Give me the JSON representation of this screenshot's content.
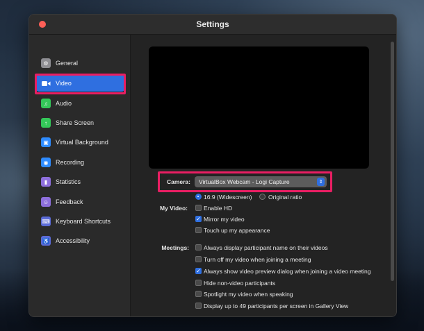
{
  "window": {
    "title": "Settings"
  },
  "sidebar": {
    "items": [
      {
        "label": "General",
        "icon": "gear-icon",
        "color": "#8e8e93"
      },
      {
        "label": "Video",
        "icon": "video-camera-icon",
        "color": "#2f6fe0",
        "active": true
      },
      {
        "label": "Audio",
        "icon": "headphones-icon",
        "color": "#34c759"
      },
      {
        "label": "Share Screen",
        "icon": "share-screen-icon",
        "color": "#34c759"
      },
      {
        "label": "Virtual Background",
        "icon": "person-background-icon",
        "color": "#2f8cff"
      },
      {
        "label": "Recording",
        "icon": "record-icon",
        "color": "#2f8cff"
      },
      {
        "label": "Statistics",
        "icon": "bar-chart-icon",
        "color": "#8e6fdc"
      },
      {
        "label": "Feedback",
        "icon": "smiley-icon",
        "color": "#8e6fdc"
      },
      {
        "label": "Keyboard Shortcuts",
        "icon": "keyboard-icon",
        "color": "#5b6bd6"
      },
      {
        "label": "Accessibility",
        "icon": "accessibility-icon",
        "color": "#5b6bd6"
      }
    ]
  },
  "video": {
    "camera_label": "Camera:",
    "camera_value": "VirtualBox Webcam - Logi Capture",
    "aspect_options": [
      {
        "label": "16:9 (Widescreen)",
        "selected": true
      },
      {
        "label": "Original ratio",
        "selected": false
      }
    ],
    "my_video_label": "My Video:",
    "my_video_options": [
      {
        "label": "Enable HD",
        "checked": false
      },
      {
        "label": "Mirror my video",
        "checked": true
      },
      {
        "label": "Touch up my appearance",
        "checked": false
      }
    ],
    "meetings_label": "Meetings:",
    "meetings_options": [
      {
        "label": "Always display participant name on their videos",
        "checked": false
      },
      {
        "label": "Turn off my video when joining a meeting",
        "checked": false
      },
      {
        "label": "Always show video preview dialog when joining a video meeting",
        "checked": true
      },
      {
        "label": "Hide non-video participants",
        "checked": false
      },
      {
        "label": "Spotlight my video when speaking",
        "checked": false
      },
      {
        "label": "Display up to 49 participants per screen in Gallery View",
        "checked": false
      }
    ]
  },
  "accent_color": "#2f6fe0",
  "highlight_color": "#e91e63"
}
